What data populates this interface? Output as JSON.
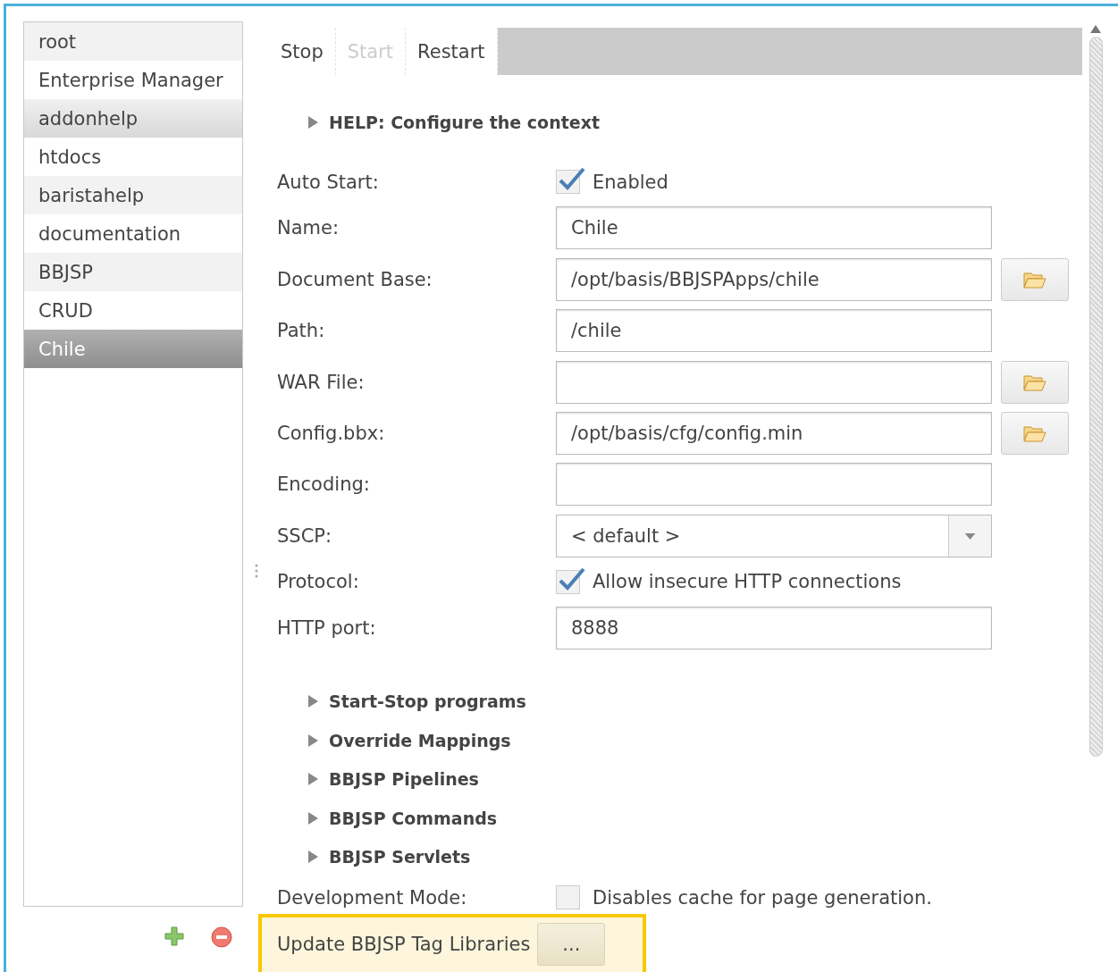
{
  "sidebar": {
    "items": [
      {
        "label": "root",
        "selected": false,
        "hovered": false
      },
      {
        "label": "Enterprise Manager",
        "selected": false,
        "hovered": false
      },
      {
        "label": "addonhelp",
        "selected": false,
        "hovered": true
      },
      {
        "label": "htdocs",
        "selected": false,
        "hovered": false
      },
      {
        "label": "baristahelp",
        "selected": false,
        "hovered": false
      },
      {
        "label": "documentation",
        "selected": false,
        "hovered": false
      },
      {
        "label": "BBJSP",
        "selected": false,
        "hovered": false
      },
      {
        "label": "CRUD",
        "selected": false,
        "hovered": false
      },
      {
        "label": "Chile",
        "selected": true,
        "hovered": false
      }
    ]
  },
  "toolbar": {
    "buttons": [
      {
        "label": "Stop",
        "disabled": false
      },
      {
        "label": "Start",
        "disabled": true
      },
      {
        "label": "Restart",
        "disabled": false
      }
    ]
  },
  "help": {
    "label": "HELP: Configure the context",
    "expanded": false
  },
  "fields": [
    {
      "kind": "checkbox",
      "label": "Auto Start:",
      "checked": true,
      "text": "Enabled"
    },
    {
      "kind": "text",
      "label": "Name:",
      "value": "Chile"
    },
    {
      "kind": "path",
      "label": "Document Base:",
      "value": "/opt/basis/BBJSPApps/chile"
    },
    {
      "kind": "text",
      "label": "Path:",
      "value": "/chile"
    },
    {
      "kind": "path",
      "label": "WAR File:"
    },
    {
      "kind": "path",
      "label": "Config.bbx:",
      "value": "/opt/basis/cfg/config.min"
    },
    {
      "kind": "text",
      "label": "Encoding:"
    },
    {
      "kind": "select",
      "label": "SSCP:",
      "value": "< default >"
    },
    {
      "kind": "checkbox",
      "label": "Protocol:",
      "checked": true,
      "text": "Allow insecure HTTP connections"
    },
    {
      "kind": "text",
      "label": "HTTP port:",
      "value": "8888"
    }
  ],
  "sections": [
    {
      "label": "Start-Stop programs",
      "expanded": false
    },
    {
      "label": "Override Mappings",
      "expanded": false
    },
    {
      "label": "BBJSP Pipelines",
      "expanded": false
    },
    {
      "label": "BBJSP Commands",
      "expanded": false
    },
    {
      "label": "BBJSP Servlets",
      "expanded": false
    }
  ],
  "development_mode": {
    "label": "Development Mode:",
    "checked": false,
    "text": "Disables cache for page generation."
  },
  "update": {
    "label": "Update BBJSP Tag Libraries",
    "button": "..."
  }
}
